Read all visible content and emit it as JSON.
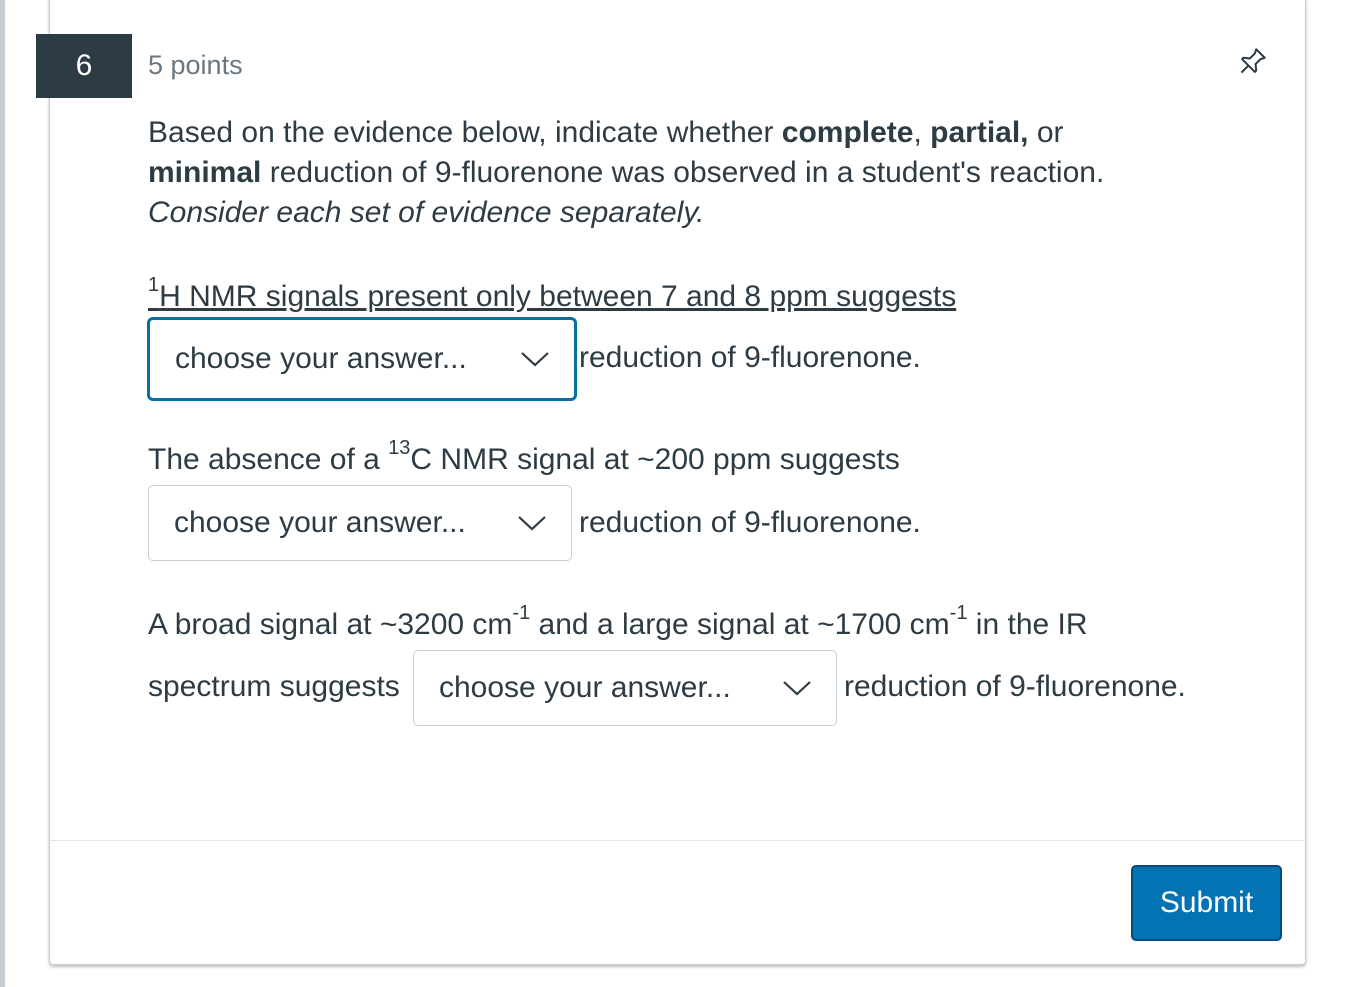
{
  "question": {
    "number": "6",
    "points": "5 points",
    "pin_icon": "pin-icon"
  },
  "prompt": {
    "part1": "Based on the evidence below, indicate whether ",
    "bold1": "complete",
    "part2": ", ",
    "bold2": "partial,",
    "part3": " or ",
    "bold3": "minimal",
    "part4": " reduction of 9-fluorenone was observed in a student's reaction. ",
    "italic": "Consider each set of evidence separately."
  },
  "items": [
    {
      "sup": "1",
      "text_before": "H NMR signals present only between 7 and 8 ppm suggests",
      "select_value": "choose your answer...",
      "text_after": "reduction of 9-fluorenone."
    },
    {
      "text_pre": "The absence of a ",
      "sup": "13",
      "text_before": "C NMR signal at ~200 ppm suggests",
      "select_value": "choose your answer...",
      "text_after": "reduction of 9-fluorenone."
    },
    {
      "text_a": "A broad signal at ~3200 cm",
      "sup_a": "-1",
      "text_b": " and a large signal at ~1700 cm",
      "sup_b": "-1",
      "text_c": " in the IR",
      "text_d": "spectrum suggests",
      "select_value": "choose your answer...",
      "text_after": "reduction of 9-fluorenone."
    }
  ],
  "footer": {
    "submit_label": "Submit"
  },
  "colors": {
    "accent": "#0373b4",
    "focus": "#0770a3",
    "number_badge": "#2d3b45"
  }
}
